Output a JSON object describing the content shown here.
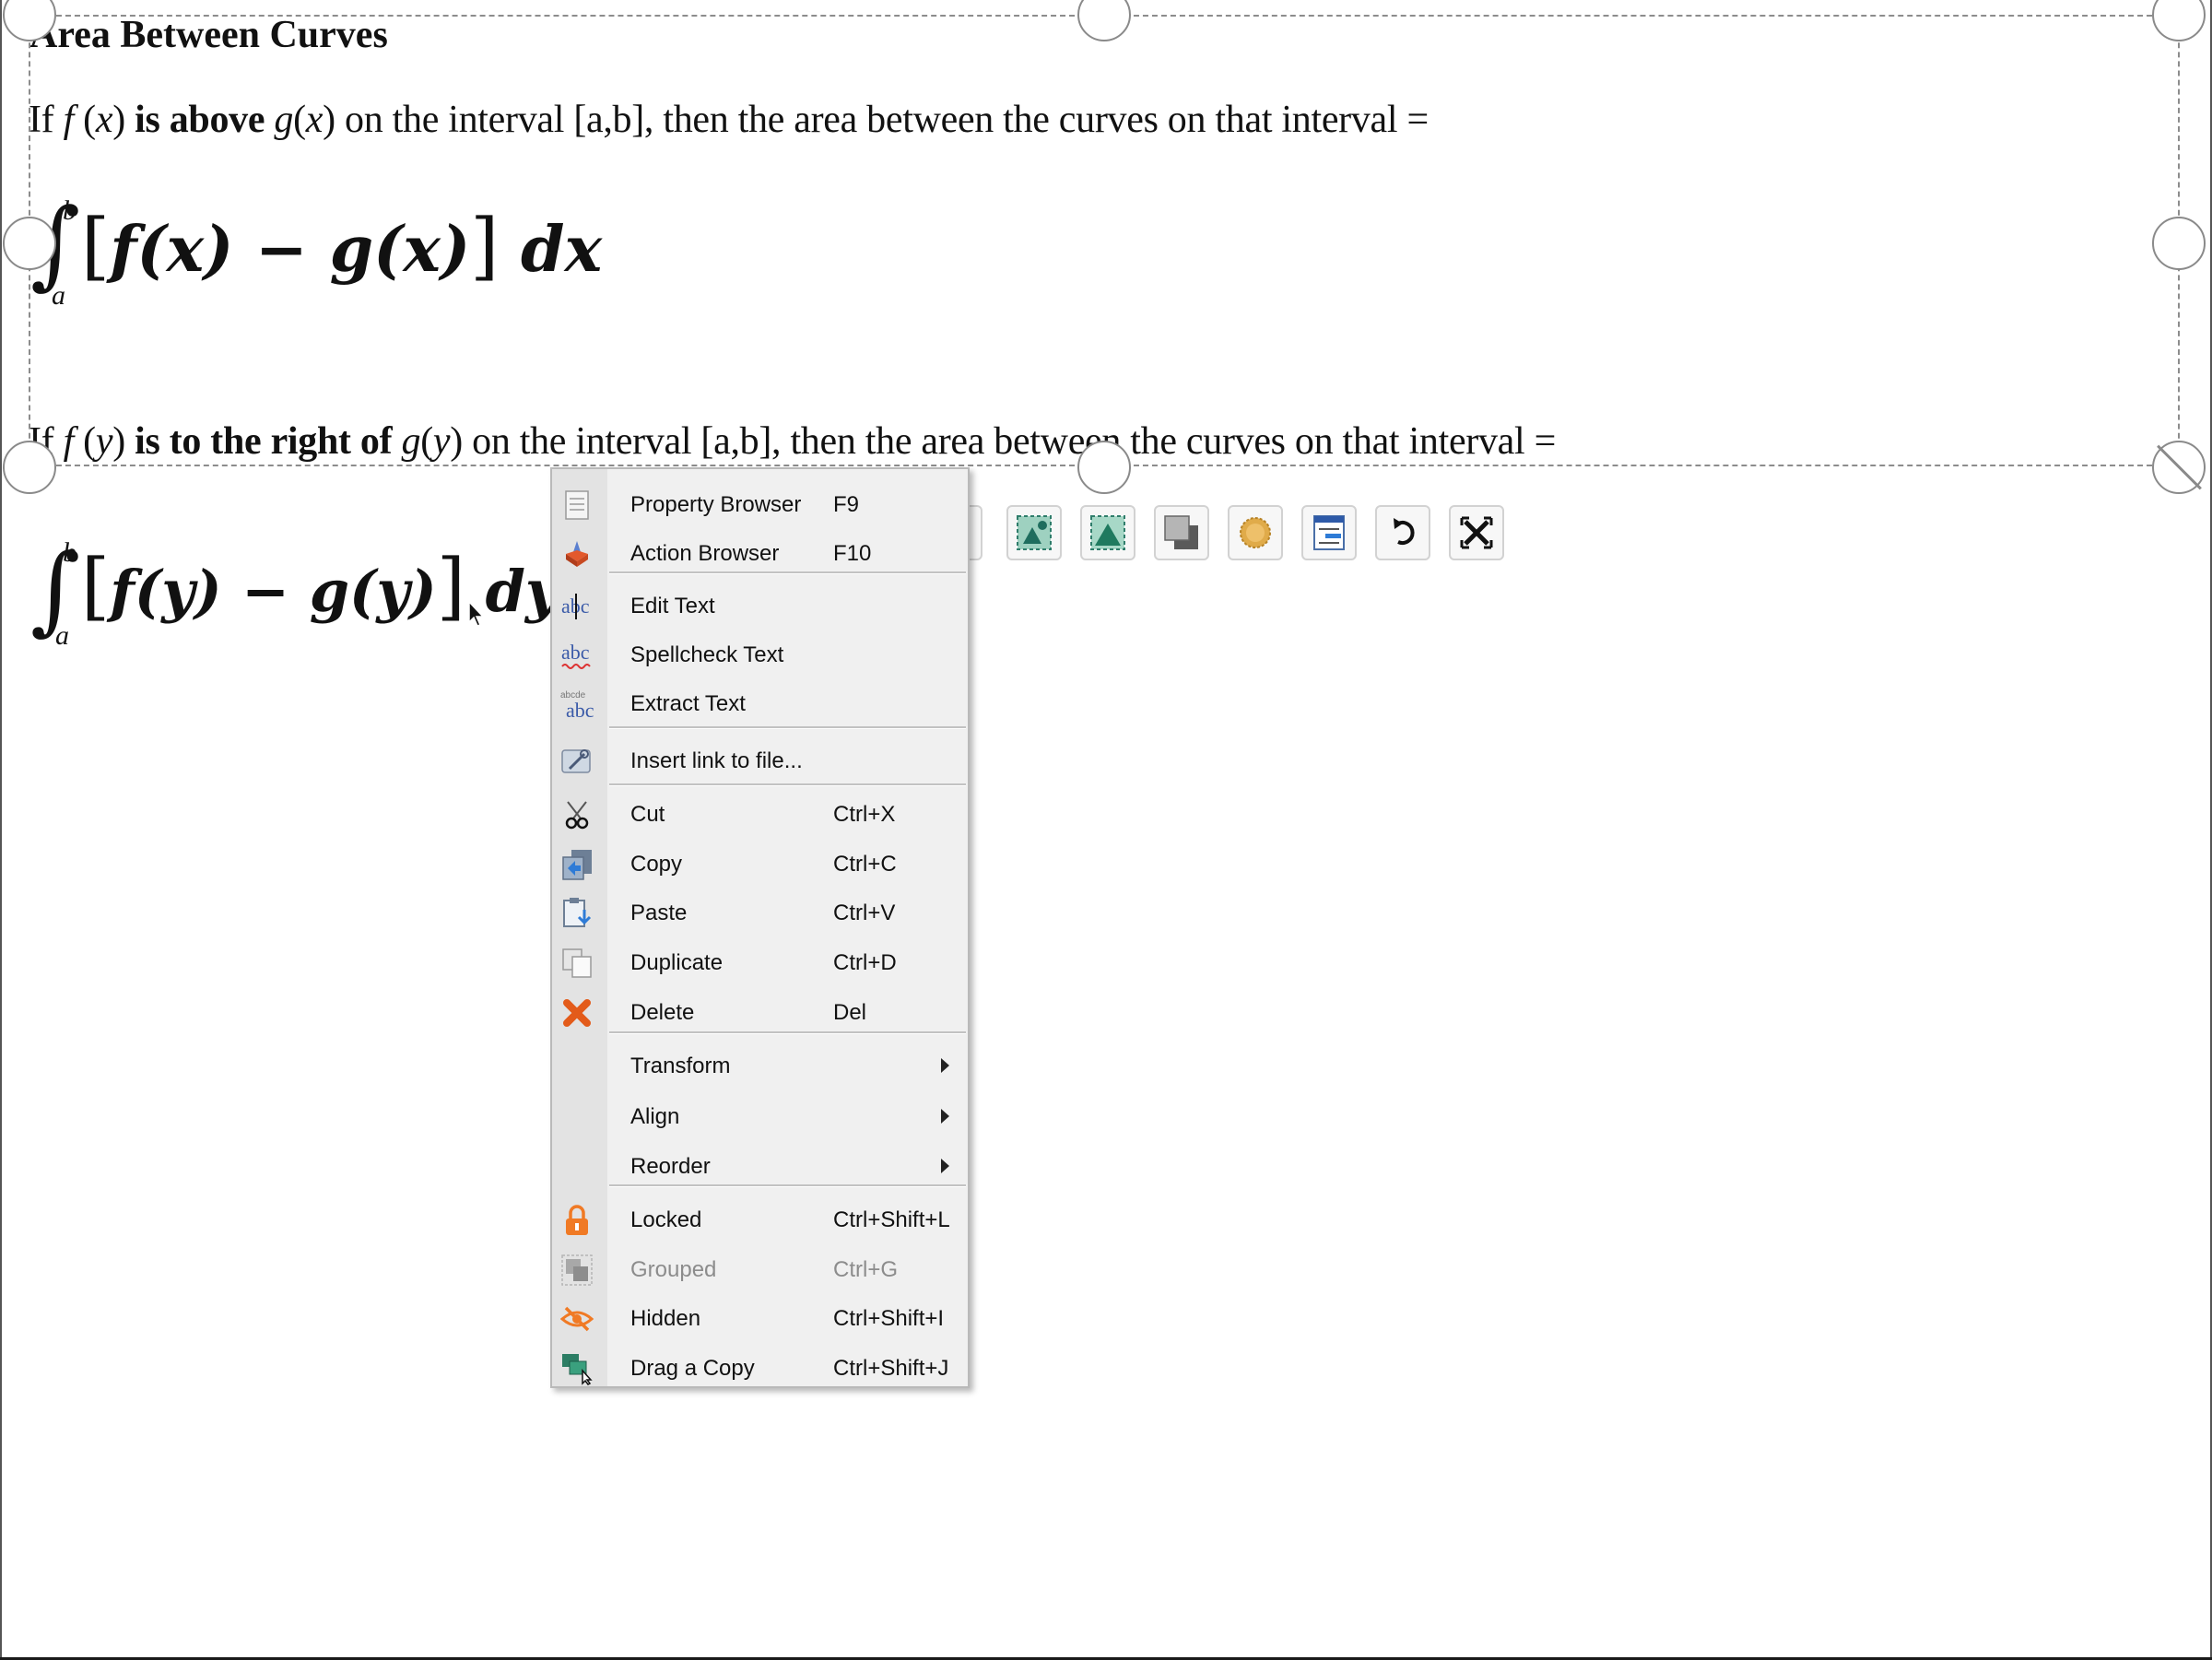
{
  "document": {
    "title": "Area Between Curves",
    "line1": {
      "p1": "If ",
      "p2": "f",
      "p3": " (",
      "p4": "x",
      "p5": ") ",
      "bold": " is above ",
      "p6": "g",
      "p7": "(",
      "p8": "x",
      "p9": ") on the interval [a,b], then the area between the curves on that interval ="
    },
    "formula1": {
      "upper": "b",
      "lower": "a",
      "lbr": "[",
      "body": "f(x) − g(x)",
      "rbr": "]",
      "diff": "dx"
    },
    "line2": {
      "p1": "If ",
      "p2": "f",
      "p3": " (",
      "p4": "y",
      "p5": ") ",
      "bold": "is to the right of ",
      "p6": "g",
      "p7": "(",
      "p8": "y",
      "p9": ") on the interval [a,b], then the area between the curves on that interval ="
    },
    "formula2": {
      "upper": "b",
      "lower": "a",
      "lbr": "[",
      "body": "f(y) − g(y)",
      "rbr": "]",
      "diff": "dy"
    }
  },
  "context_menu": {
    "items": [
      {
        "label": "Property Browser",
        "shortcut": "F9",
        "icon": "property-browser-icon"
      },
      {
        "label": "Action Browser",
        "shortcut": "F10",
        "icon": "action-browser-icon"
      },
      {
        "label": "Edit Text",
        "shortcut": "",
        "icon": "edit-text-icon"
      },
      {
        "label": "Spellcheck Text",
        "shortcut": "",
        "icon": "spellcheck-icon"
      },
      {
        "label": "Extract Text",
        "shortcut": "",
        "icon": "extract-text-icon"
      },
      {
        "label": "Insert link to file...",
        "shortcut": "",
        "icon": "insert-link-icon"
      },
      {
        "label": "Cut",
        "shortcut": "Ctrl+X",
        "icon": "scissors-icon"
      },
      {
        "label": "Copy",
        "shortcut": "Ctrl+C",
        "icon": "copy-icon"
      },
      {
        "label": "Paste",
        "shortcut": "Ctrl+V",
        "icon": "paste-icon"
      },
      {
        "label": "Duplicate",
        "shortcut": "Ctrl+D",
        "icon": "duplicate-icon"
      },
      {
        "label": "Delete",
        "shortcut": "Del",
        "icon": "delete-x-icon"
      },
      {
        "label": "Transform",
        "shortcut": "",
        "icon": "",
        "submenu": true
      },
      {
        "label": "Align",
        "shortcut": "",
        "icon": "",
        "submenu": true
      },
      {
        "label": "Reorder",
        "shortcut": "",
        "icon": "",
        "submenu": true
      },
      {
        "label": "Locked",
        "shortcut": "Ctrl+Shift+L",
        "icon": "lock-icon"
      },
      {
        "label": "Grouped",
        "shortcut": "Ctrl+G",
        "icon": "group-icon",
        "disabled": true
      },
      {
        "label": "Hidden",
        "shortcut": "Ctrl+Shift+I",
        "icon": "hidden-eye-icon"
      },
      {
        "label": "Drag a Copy",
        "shortcut": "Ctrl+Shift+J",
        "icon": "drag-copy-icon"
      }
    ]
  },
  "object_toolbar": {
    "buttons": [
      "crop-icon",
      "mask-icon",
      "image-fill-icon",
      "shadow-icon",
      "brightness-icon",
      "properties-icon",
      "rotate-icon",
      "close-icon"
    ]
  },
  "colors": {
    "menu_bg": "#f0f0f0",
    "gutter_bg": "#e3e3e3",
    "delete_red": "#e35b1a",
    "lock_orange": "#f07a25",
    "selection_dash": "#8c8c8c"
  }
}
